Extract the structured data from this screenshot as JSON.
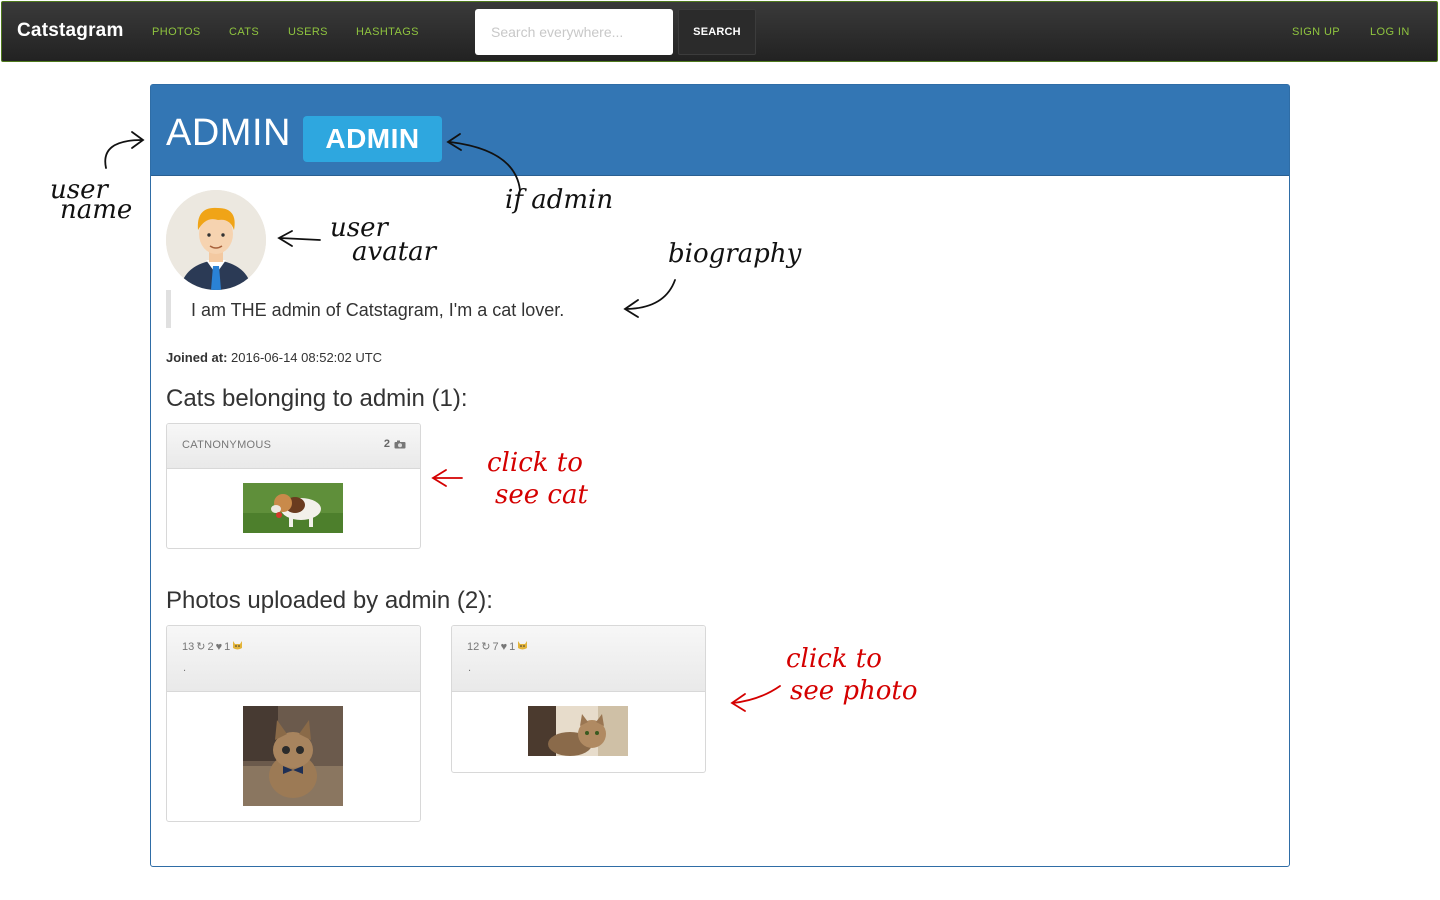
{
  "nav": {
    "brand": "Catstagram",
    "links": [
      "PHOTOS",
      "CATS",
      "USERS",
      "HASHTAGS"
    ],
    "search_placeholder": "Search everywhere...",
    "search_button": "SEARCH",
    "signup": "SIGN UP",
    "login": "LOG IN"
  },
  "profile": {
    "username": "ADMIN",
    "badge": "ADMIN",
    "bio": "I am THE admin of Catstagram, I'm a cat lover.",
    "joined_label": "Joined at:",
    "joined_value": "2016-06-14 08:52:02 UTC"
  },
  "cats_section": {
    "title": "Cats belonging to admin (1):",
    "items": [
      {
        "name": "CATNONYMOUS",
        "count": "2"
      }
    ]
  },
  "photos_section": {
    "title": "Photos uploaded by admin (2):",
    "items": [
      {
        "views": "13",
        "reposts": "2",
        "likes": "1",
        "caption": "."
      },
      {
        "views": "12",
        "reposts": "7",
        "likes": "1",
        "caption": "."
      }
    ]
  },
  "annotations": {
    "user_name": [
      "user",
      "name"
    ],
    "if_admin": "if admin",
    "user_avatar": [
      "user",
      "avatar"
    ],
    "biography": "biography",
    "click_cat": [
      "click to",
      "see cat"
    ],
    "click_photo": [
      "click to",
      "see photo"
    ]
  },
  "colors": {
    "nav_link": "#8fc43f",
    "panel_header": "#3376b4",
    "badge": "#2ea7df",
    "annotation_red": "#d40000"
  }
}
